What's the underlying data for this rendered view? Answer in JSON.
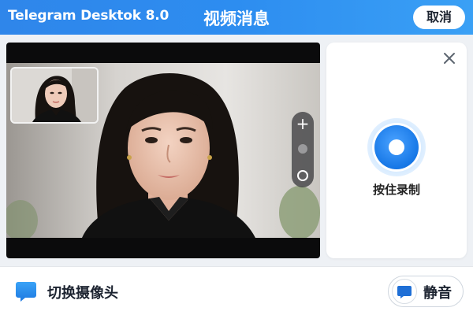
{
  "header": {
    "app_title": "Telegram Desktok 8.0",
    "page_title": "视频消息",
    "cancel_label": "取消"
  },
  "video": {
    "main_feed": "camera-preview",
    "pip_feed": "camera-thumbnail",
    "zoom": {
      "plus_icon": "plus-icon",
      "reset_icon": "circle-icon"
    }
  },
  "record": {
    "close_icon": "close-icon",
    "label": "按住录制",
    "accent": "#1677e6"
  },
  "bottom": {
    "switch_camera_label": "切换摄像头",
    "mute_label": "静音",
    "accent": "#2f86ea"
  }
}
